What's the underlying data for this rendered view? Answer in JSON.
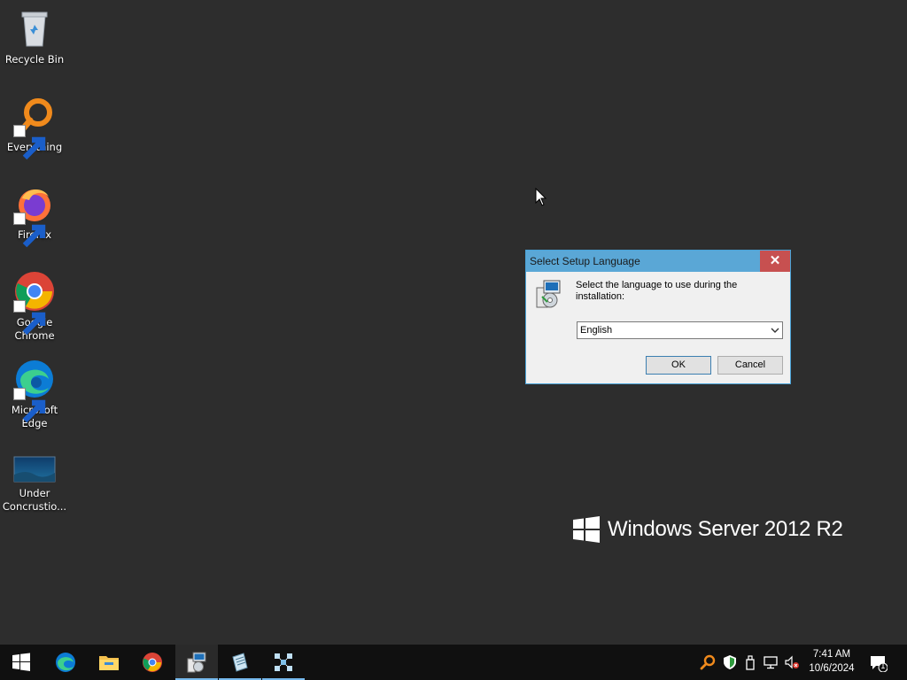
{
  "desktop": {
    "icons": [
      {
        "label": "Recycle Bin",
        "icon": "recycle-bin-icon"
      },
      {
        "label": "Everything",
        "icon": "everything-search-icon"
      },
      {
        "label": "Firefox",
        "icon": "firefox-icon"
      },
      {
        "label": "Google Chrome",
        "icon": "chrome-icon"
      },
      {
        "label": "Microsoft Edge",
        "icon": "edge-icon"
      },
      {
        "label": "Under Concrustio...",
        "icon": "picture-thumbnail-icon"
      }
    ],
    "branding": "Windows Server 2012 R2"
  },
  "dialog": {
    "title": "Select Setup Language",
    "close_label": "✕",
    "prompt": "Select the language to use during the installation:",
    "language_selected": "English",
    "ok_label": "OK",
    "cancel_label": "Cancel"
  },
  "taskbar": {
    "items": [
      "start-icon",
      "edge-icon",
      "file-explorer-icon",
      "chrome-icon",
      "setup-icon",
      "notepad-icon",
      "network-tool-icon"
    ],
    "clock_time": "7:41 AM",
    "clock_date": "10/6/2024",
    "notification_count": "1"
  },
  "colors": {
    "desktop_bg": "#2d2d2d",
    "taskbar_bg": "#101010",
    "dialog_title_bg": "#5aa7d6",
    "close_bg": "#c75050"
  }
}
